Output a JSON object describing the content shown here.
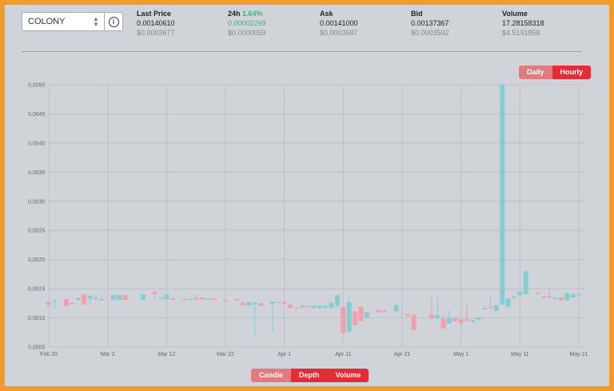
{
  "market": {
    "selected": "COLONY"
  },
  "stats": [
    {
      "label": "Last Price",
      "pct": "",
      "v1": "0.00140610",
      "v2": "$0.0003677",
      "green": false
    },
    {
      "label": "24h",
      "pct": "1.64%",
      "v1": "0.00002269",
      "v2": "$0.0000059",
      "green": true
    },
    {
      "label": "Ask",
      "pct": "",
      "v1": "0.00141000",
      "v2": "$0.0003687",
      "green": false
    },
    {
      "label": "Bid",
      "pct": "",
      "v1": "0.00137367",
      "v2": "$0.0003592",
      "green": false
    },
    {
      "label": "Volume",
      "pct": "",
      "v1": "17.28158318",
      "v2": "$4.5191858",
      "green": false
    }
  ],
  "interval_buttons": {
    "daily": "Daily",
    "hourly": "Hourly",
    "active": "Hourly"
  },
  "view_buttons": {
    "candle": "Candle",
    "depth": "Depth",
    "volume": "Volume",
    "active": "Depth"
  },
  "colors": {
    "up": "#86cdd0",
    "down": "#f0a0ac",
    "grid": "#bdc0c7",
    "active_button": "#e32d36",
    "inactive_button": "#e07b80",
    "border": "#f39b2a"
  },
  "chart_data": {
    "type": "candlestick",
    "title": "",
    "xlabel": "",
    "ylabel": "",
    "ylim": [
      0.0005,
      0.005
    ],
    "yticks": [
      "0,0050",
      "0,0045",
      "0,0040",
      "0,0035",
      "0,0030",
      "0,0025",
      "0,0020",
      "0,0015",
      "0,0010",
      "0,0005"
    ],
    "xlim": [
      "2018-02-20",
      "2018-05-21"
    ],
    "xticks": [
      {
        "date": "2018-02-20",
        "label": "Feb 20"
      },
      {
        "date": "2018-03-02",
        "label": "Mar 2"
      },
      {
        "date": "2018-03-12",
        "label": "Mar 12"
      },
      {
        "date": "2018-03-22",
        "label": "Mar 22"
      },
      {
        "date": "2018-04-01",
        "label": "Apr 1"
      },
      {
        "date": "2018-04-11",
        "label": "Apr 11"
      },
      {
        "date": "2018-04-21",
        "label": "Apr 21"
      },
      {
        "date": "2018-05-01",
        "label": "May 1"
      },
      {
        "date": "2018-05-11",
        "label": "May 11"
      },
      {
        "date": "2018-05-21",
        "label": "May 21"
      }
    ],
    "grid": true,
    "candles": [
      {
        "date": "2018-02-20",
        "open": 0.00127,
        "close": 0.00122,
        "high": 0.00128,
        "low": 0.00121
      },
      {
        "date": "2018-02-21",
        "open": 0.00129,
        "close": 0.00131,
        "high": 0.00131,
        "low": 0.00116
      },
      {
        "date": "2018-02-23",
        "open": 0.00132,
        "close": 0.00121,
        "high": 0.00132,
        "low": 0.0012
      },
      {
        "date": "2018-02-24",
        "open": 0.00126,
        "close": 0.00124,
        "high": 0.00127,
        "low": 0.00122
      },
      {
        "date": "2018-02-25",
        "open": 0.00131,
        "close": 0.00134,
        "high": 0.00135,
        "low": 0.0013
      },
      {
        "date": "2018-02-26",
        "open": 0.0014,
        "close": 0.00123,
        "high": 0.00141,
        "low": 0.00122
      },
      {
        "date": "2018-02-27",
        "open": 0.00133,
        "close": 0.00138,
        "high": 0.00139,
        "low": 0.00125
      },
      {
        "date": "2018-02-28",
        "open": 0.00133,
        "close": 0.00134,
        "high": 0.00138,
        "low": 0.00132
      },
      {
        "date": "2018-03-01",
        "open": 0.00131,
        "close": 0.00132,
        "high": 0.00139,
        "low": 0.0013
      },
      {
        "date": "2018-03-03",
        "open": 0.00131,
        "close": 0.00139,
        "high": 0.00139,
        "low": 0.00131
      },
      {
        "date": "2018-03-04",
        "open": 0.00131,
        "close": 0.00139,
        "high": 0.00139,
        "low": 0.00131
      },
      {
        "date": "2018-03-05",
        "open": 0.00139,
        "close": 0.00131,
        "high": 0.00139,
        "low": 0.0013
      },
      {
        "date": "2018-03-08",
        "open": 0.00131,
        "close": 0.0014,
        "high": 0.0014,
        "low": 0.00131
      },
      {
        "date": "2018-03-10",
        "open": 0.00145,
        "close": 0.00141,
        "high": 0.00145,
        "low": 0.00131
      },
      {
        "date": "2018-03-11",
        "open": 0.00133,
        "close": 0.00135,
        "high": 0.00135,
        "low": 0.00132
      },
      {
        "date": "2018-03-12",
        "open": 0.00132,
        "close": 0.0014,
        "high": 0.0014,
        "low": 0.00132
      },
      {
        "date": "2018-03-13",
        "open": 0.00133,
        "close": 0.00132,
        "high": 0.00134,
        "low": 0.00131
      },
      {
        "date": "2018-03-15",
        "open": 0.00133,
        "close": 0.00132,
        "high": 0.00133,
        "low": 0.00131
      },
      {
        "date": "2018-03-16",
        "open": 0.00132,
        "close": 0.00133,
        "high": 0.00133,
        "low": 0.00131
      },
      {
        "date": "2018-03-17",
        "open": 0.00133,
        "close": 0.00131,
        "high": 0.00139,
        "low": 0.00131
      },
      {
        "date": "2018-03-18",
        "open": 0.00135,
        "close": 0.00132,
        "high": 0.00136,
        "low": 0.00131
      },
      {
        "date": "2018-03-19",
        "open": 0.00132,
        "close": 0.00133,
        "high": 0.00134,
        "low": 0.00131
      },
      {
        "date": "2018-03-20",
        "open": 0.00133,
        "close": 0.00131,
        "high": 0.00133,
        "low": 0.0013
      },
      {
        "date": "2018-03-22",
        "open": 0.00131,
        "close": 0.0013,
        "high": 0.00132,
        "low": 0.00129
      },
      {
        "date": "2018-03-24",
        "open": 0.00132,
        "close": 0.0013,
        "high": 0.00133,
        "low": 0.00129
      },
      {
        "date": "2018-03-25",
        "open": 0.00126,
        "close": 0.00122,
        "high": 0.00127,
        "low": 0.00121
      },
      {
        "date": "2018-03-26",
        "open": 0.00121,
        "close": 0.00127,
        "high": 0.00127,
        "low": 0.00121
      },
      {
        "date": "2018-03-27",
        "open": 0.00123,
        "close": 0.00126,
        "high": 0.00126,
        "low": 0.00067
      },
      {
        "date": "2018-03-28",
        "open": 0.00125,
        "close": 0.00121,
        "high": 0.00126,
        "low": 0.0012
      },
      {
        "date": "2018-03-30",
        "open": 0.00124,
        "close": 0.00128,
        "high": 0.00128,
        "low": 0.00074
      },
      {
        "date": "2018-03-31",
        "open": 0.00128,
        "close": 0.00126,
        "high": 0.00128,
        "low": 0.00125
      },
      {
        "date": "2018-04-01",
        "open": 0.00127,
        "close": 0.00124,
        "high": 0.00128,
        "low": 0.00123
      },
      {
        "date": "2018-04-02",
        "open": 0.00123,
        "close": 0.00117,
        "high": 0.00124,
        "low": 0.00116
      },
      {
        "date": "2018-04-03",
        "open": 0.00117,
        "close": 0.00116,
        "high": 0.00118,
        "low": 0.00115
      },
      {
        "date": "2018-04-04",
        "open": 0.00118,
        "close": 0.00121,
        "high": 0.00121,
        "low": 0.00117
      },
      {
        "date": "2018-04-05",
        "open": 0.0012,
        "close": 0.00118,
        "high": 0.00121,
        "low": 0.00117
      },
      {
        "date": "2018-04-06",
        "open": 0.00117,
        "close": 0.00121,
        "high": 0.00121,
        "low": 0.00116
      },
      {
        "date": "2018-04-07",
        "open": 0.00117,
        "close": 0.00121,
        "high": 0.00121,
        "low": 0.00116
      },
      {
        "date": "2018-04-08",
        "open": 0.00117,
        "close": 0.00121,
        "high": 0.00121,
        "low": 0.00116
      },
      {
        "date": "2018-04-09",
        "open": 0.00117,
        "close": 0.00126,
        "high": 0.00126,
        "low": 0.00116
      },
      {
        "date": "2018-04-10",
        "open": 0.00121,
        "close": 0.00139,
        "high": 0.00139,
        "low": 0.00119
      },
      {
        "date": "2018-04-11",
        "open": 0.00119,
        "close": 0.00074,
        "high": 0.00119,
        "low": 0.00074
      },
      {
        "date": "2018-04-12",
        "open": 0.00076,
        "close": 0.00127,
        "high": 0.00137,
        "low": 0.00076
      },
      {
        "date": "2018-04-13",
        "open": 0.00111,
        "close": 0.00088,
        "high": 0.00112,
        "low": 0.00087
      },
      {
        "date": "2018-04-14",
        "open": 0.00119,
        "close": 0.00095,
        "high": 0.0012,
        "low": 0.00094
      },
      {
        "date": "2018-04-15",
        "open": 0.001,
        "close": 0.0011,
        "high": 0.0011,
        "low": 0.00099
      },
      {
        "date": "2018-04-17",
        "open": 0.00113,
        "close": 0.0011,
        "high": 0.00114,
        "low": 0.00109
      },
      {
        "date": "2018-04-18",
        "open": 0.00112,
        "close": 0.00111,
        "high": 0.00114,
        "low": 0.0011
      },
      {
        "date": "2018-04-20",
        "open": 0.00111,
        "close": 0.00122,
        "high": 0.00122,
        "low": 0.0011
      },
      {
        "date": "2018-04-22",
        "open": 0.00106,
        "close": 0.00103,
        "high": 0.00107,
        "low": 0.00102
      },
      {
        "date": "2018-04-23",
        "open": 0.00105,
        "close": 0.00079,
        "high": 0.00106,
        "low": 0.00079
      },
      {
        "date": "2018-04-26",
        "open": 0.00106,
        "close": 0.00099,
        "high": 0.00138,
        "low": 0.00098
      },
      {
        "date": "2018-04-27",
        "open": 0.00099,
        "close": 0.00105,
        "high": 0.00138,
        "low": 0.00098
      },
      {
        "date": "2018-04-28",
        "open": 0.00099,
        "close": 0.00082,
        "high": 0.001,
        "low": 0.00081
      },
      {
        "date": "2018-04-29",
        "open": 0.0009,
        "close": 0.001,
        "high": 0.00114,
        "low": 0.00089
      },
      {
        "date": "2018-04-30",
        "open": 0.00099,
        "close": 0.00094,
        "high": 0.001,
        "low": 0.00093
      },
      {
        "date": "2018-05-01",
        "open": 0.00097,
        "close": 0.00091,
        "high": 0.00098,
        "low": 0.0009
      },
      {
        "date": "2018-05-02",
        "open": 0.00098,
        "close": 0.00095,
        "high": 0.00124,
        "low": 0.00094
      },
      {
        "date": "2018-05-03",
        "open": 0.00093,
        "close": 0.00096,
        "high": 0.00097,
        "low": 0.00092
      },
      {
        "date": "2018-05-04",
        "open": 0.00097,
        "close": 0.001,
        "high": 0.00101,
        "low": 0.00095
      },
      {
        "date": "2018-05-05",
        "open": 0.00115,
        "close": 0.00117,
        "high": 0.00119,
        "low": 0.00114
      },
      {
        "date": "2018-05-06",
        "open": 0.00119,
        "close": 0.00118,
        "high": 0.00138,
        "low": 0.00117
      },
      {
        "date": "2018-05-07",
        "open": 0.00112,
        "close": 0.00122,
        "high": 0.00123,
        "low": 0.00112
      },
      {
        "date": "2018-05-08",
        "open": 0.00123,
        "close": 0.005,
        "high": 0.005,
        "low": 0.00122
      },
      {
        "date": "2018-05-09",
        "open": 0.00119,
        "close": 0.00133,
        "high": 0.00134,
        "low": 0.00118
      },
      {
        "date": "2018-05-10",
        "open": 0.00135,
        "close": 0.00137,
        "high": 0.00138,
        "low": 0.0013
      },
      {
        "date": "2018-05-11",
        "open": 0.00139,
        "close": 0.00145,
        "high": 0.00146,
        "low": 0.00138
      },
      {
        "date": "2018-05-12",
        "open": 0.00141,
        "close": 0.0018,
        "high": 0.00181,
        "low": 0.0014
      },
      {
        "date": "2018-05-14",
        "open": 0.00143,
        "close": 0.00142,
        "high": 0.00144,
        "low": 0.0014
      },
      {
        "date": "2018-05-15",
        "open": 0.00136,
        "close": 0.00135,
        "high": 0.00137,
        "low": 0.00134
      },
      {
        "date": "2018-05-16",
        "open": 0.00137,
        "close": 0.00135,
        "high": 0.00149,
        "low": 0.00134
      },
      {
        "date": "2018-05-17",
        "open": 0.00134,
        "close": 0.00135,
        "high": 0.00136,
        "low": 0.00133
      },
      {
        "date": "2018-05-18",
        "open": 0.00135,
        "close": 0.0013,
        "high": 0.00136,
        "low": 0.00129
      },
      {
        "date": "2018-05-19",
        "open": 0.0013,
        "close": 0.00134,
        "high": 0.00135,
        "low": 0.00129
      },
      {
        "date": "2018-05-19",
        "open": 0.00133,
        "close": 0.00143,
        "high": 0.00143,
        "low": 0.00132
      },
      {
        "date": "2018-05-20",
        "open": 0.00135,
        "close": 0.00141,
        "high": 0.00142,
        "low": 0.00134
      },
      {
        "date": "2018-05-21",
        "open": 0.0014,
        "close": 0.00141,
        "high": 0.00142,
        "low": 0.00139
      }
    ]
  }
}
